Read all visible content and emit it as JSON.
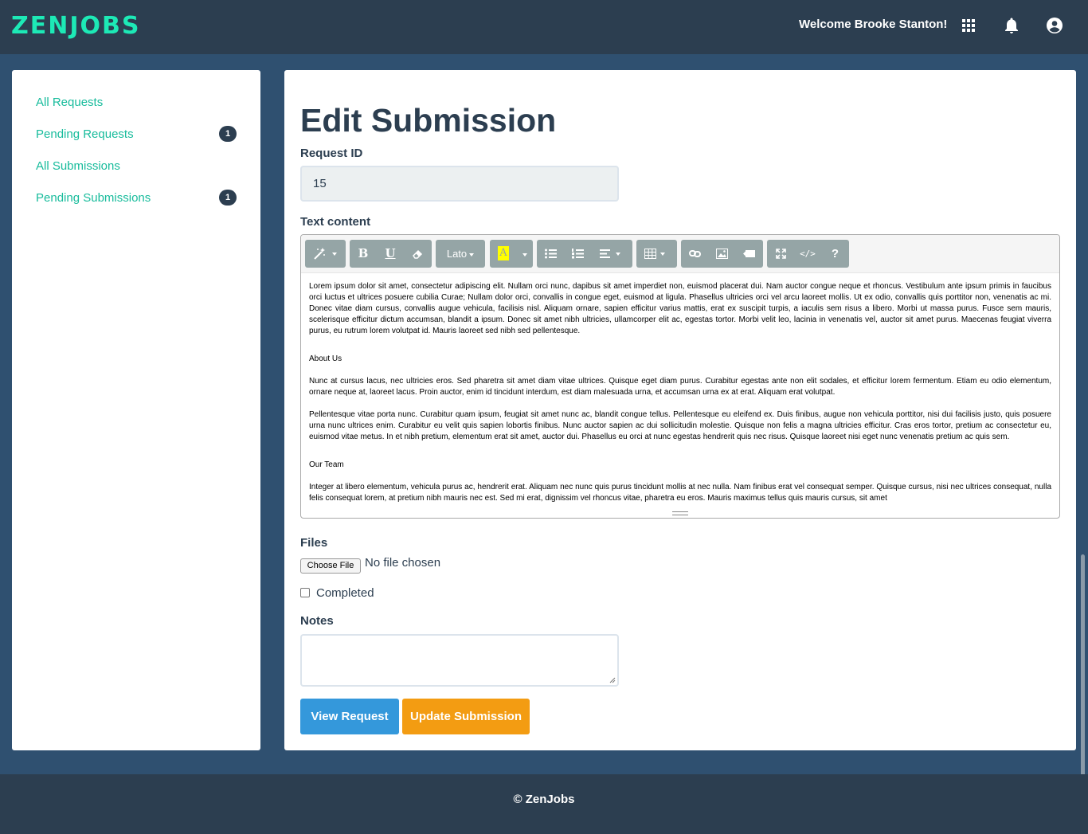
{
  "brand": {
    "logo_text": "ZENJOBS",
    "accent_color": "#1de9b6"
  },
  "header": {
    "welcome": "Welcome Brooke Stanton!",
    "icons": [
      "apps-grid-icon",
      "bell-icon",
      "account-icon"
    ]
  },
  "sidebar": {
    "items": [
      {
        "label": "All Requests",
        "badge": ""
      },
      {
        "label": "Pending Requests",
        "badge": "1"
      },
      {
        "label": "All Submissions",
        "badge": ""
      },
      {
        "label": "Pending Submissions",
        "badge": "1"
      }
    ]
  },
  "main": {
    "title": "Edit Submission",
    "request_id": {
      "label": "Request ID",
      "value": "15"
    },
    "text_content": {
      "label": "Text content",
      "toolbar": {
        "font": "Lato",
        "buttons": [
          "style-wand-icon",
          "bold-icon",
          "underline-icon",
          "eraser-icon",
          "font-family",
          "highlight-icon",
          "unordered-list-icon",
          "ordered-list-icon",
          "align-icon",
          "table-icon",
          "link-icon",
          "picture-icon",
          "video-icon",
          "fullscreen-icon",
          "code-view-icon",
          "help-icon"
        ],
        "bold": "B",
        "underline": "U",
        "highlight": "A",
        "code": "</>",
        "help": "?"
      },
      "paragraphs": [
        "Lorem ipsum dolor sit amet, consectetur adipiscing elit. Nullam orci nunc, dapibus sit amet imperdiet non, euismod placerat dui. Nam auctor congue neque et rhoncus. Vestibulum ante ipsum primis in faucibus orci luctus et ultrices posuere cubilia Curae; Nullam dolor orci, convallis in congue eget, euismod at ligula. Phasellus ultricies orci vel arcu laoreet mollis. Ut ex odio, convallis quis porttitor non, venenatis ac mi. Donec vitae diam cursus, convallis augue vehicula, facilisis nisl. Aliquam ornare, sapien efficitur varius mattis, erat ex suscipit turpis, a iaculis sem risus a libero. Morbi ut massa purus. Fusce sem mauris, scelerisque efficitur dictum accumsan, blandit a ipsum. Donec sit amet nibh ultricies, ullamcorper elit ac, egestas tortor. Morbi velit leo, lacinia in venenatis vel, auctor sit amet purus. Maecenas feugiat viverra purus, eu rutrum lorem volutpat id. Mauris laoreet sed nibh sed pellentesque.",
        "About Us",
        "Nunc at cursus lacus, nec ultricies eros. Sed pharetra sit amet diam vitae ultrices. Quisque eget diam purus. Curabitur egestas ante non elit sodales, et efficitur lorem fermentum. Etiam eu odio elementum, ornare neque at, laoreet lacus. Proin auctor, enim id tincidunt interdum, est diam malesuada urna, et accumsan urna ex at erat. Aliquam erat volutpat.",
        "Pellentesque vitae porta nunc. Curabitur quam ipsum, feugiat sit amet nunc ac, blandit congue tellus. Pellentesque eu eleifend ex. Duis finibus, augue non vehicula porttitor, nisi dui facilisis justo, quis posuere urna nunc ultrices enim. Curabitur eu velit quis sapien lobortis finibus. Nunc auctor sapien ac dui sollicitudin molestie. Quisque non felis a magna ultricies efficitur. Cras eros tortor, pretium ac consectetur eu, euismod vitae metus. In et nibh pretium, elementum erat sit amet, auctor dui. Phasellus eu orci at nunc egestas hendrerit quis nec risus. Quisque laoreet nisi eget nunc venenatis pretium ac quis sem.",
        "Our Team",
        "Integer at libero elementum, vehicula purus ac, hendrerit erat. Aliquam nec nunc quis purus tincidunt mollis at nec nulla. Nam finibus erat vel consequat semper. Quisque cursus, nisi nec ultrices consequat, nulla felis consequat lorem, at pretium nibh mauris nec est. Sed mi erat, dignissim vel rhoncus vitae, pharetra eu eros. Mauris maximus tellus quis mauris cursus, sit amet"
      ]
    },
    "files": {
      "label": "Files",
      "button": "Choose File",
      "status": "No file chosen"
    },
    "completed": {
      "label": "Completed",
      "checked": false
    },
    "notes": {
      "label": "Notes",
      "value": ""
    },
    "actions": {
      "view": {
        "label": "View Request",
        "color": "#3498db"
      },
      "update": {
        "label": "Update Submission",
        "color": "#f39c12"
      }
    }
  },
  "footer": {
    "text": "© ZenJobs"
  }
}
